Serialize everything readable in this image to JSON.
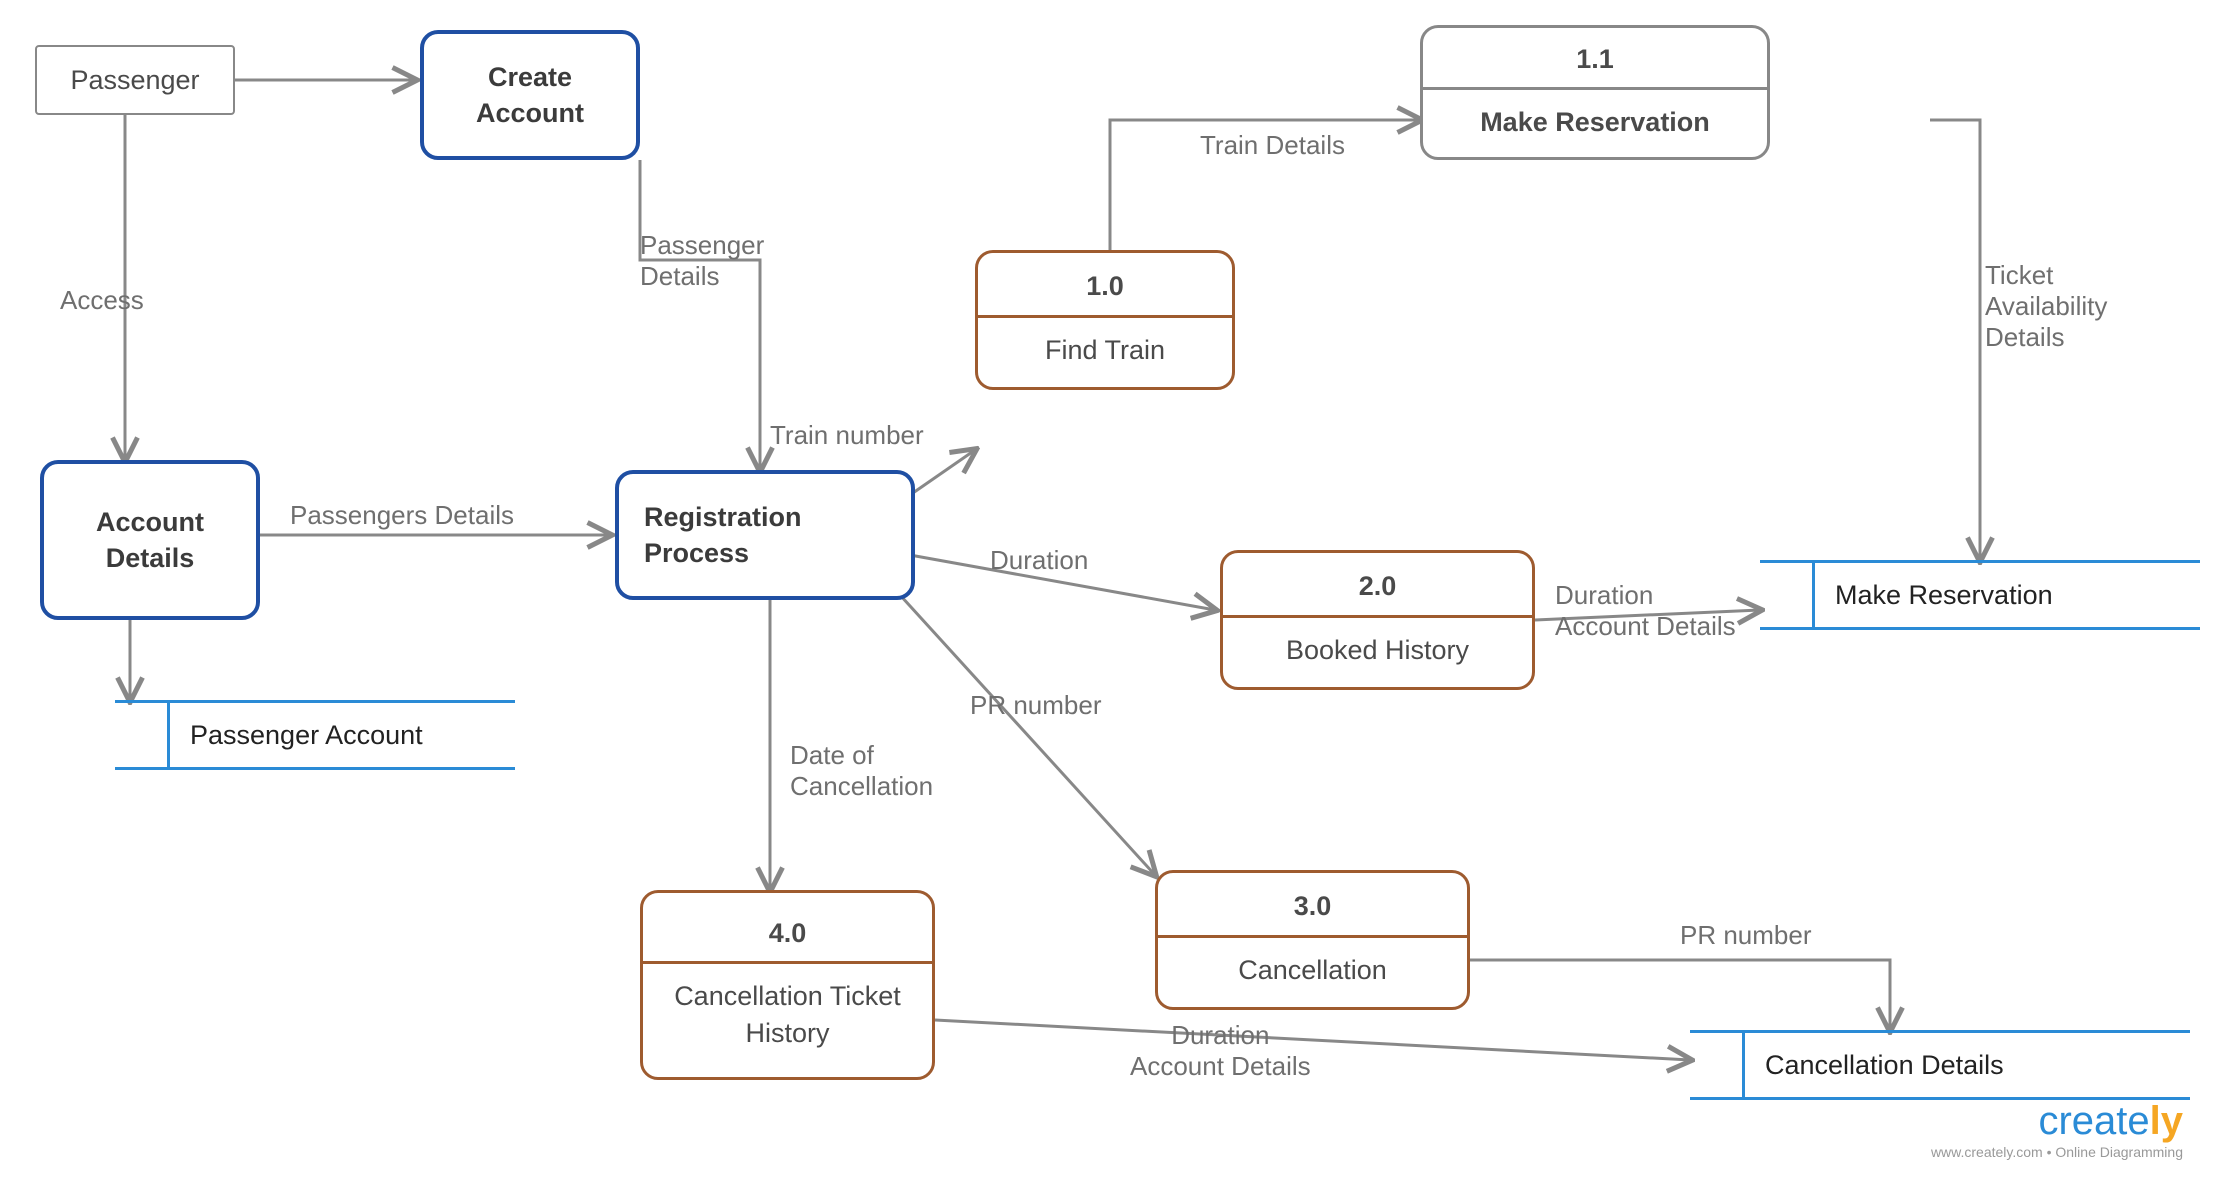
{
  "entities": {
    "passenger": "Passenger",
    "create_account": "Create Account",
    "account_details": "Account Details",
    "registration": "Registration Process",
    "make_reservation_proc": {
      "num": "1.1",
      "label": "Make Reservation"
    },
    "find_train": {
      "num": "1.0",
      "label": "Find Train"
    },
    "booked_history": {
      "num": "2.0",
      "label": "Booked History"
    },
    "cancellation": {
      "num": "3.0",
      "label": "Cancellation"
    },
    "cancel_hist": {
      "num": "4.0",
      "label": "Cancellation Ticket History"
    }
  },
  "stores": {
    "passenger_account": "Passenger Account",
    "make_reservation": "Make Reservation",
    "cancel_details": "Cancellation Details"
  },
  "edges": {
    "access": "Access",
    "passengers_details": "Passengers Details",
    "passenger_details": "Passenger Details",
    "train_number": "Train number",
    "train_details": "Train Details",
    "ticket_avail": "Ticket Availability Details",
    "duration1": "Duration",
    "duration2": "Duration Account Details",
    "pr_number": "PR number",
    "pr_number2": "PR number",
    "date_cancel": "Date of Cancellation",
    "duration3": "Duration Account Details"
  },
  "watermark": {
    "brand": "create",
    "suffix": "ly",
    "tag": "www.creately.com • Online Diagramming"
  }
}
